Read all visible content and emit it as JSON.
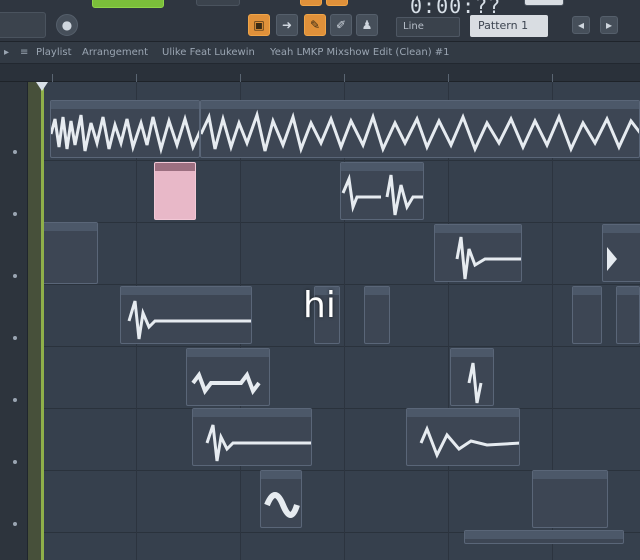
{
  "toolbar": {
    "time_display": "0:00:??",
    "snap_value": "Line",
    "pattern_value": "Pattern 1"
  },
  "breadcrumb": {
    "items": [
      "Playlist",
      "Arrangement",
      "Ulike Feat Lukewin",
      "Yeah LMKP Mixshow Edit (Clean) #1"
    ]
  },
  "overlay_text": "hi",
  "colors": {
    "background": "#36404d",
    "toolbar": "#2f3640",
    "accent_orange": "#e0913a",
    "accent_green": "#7bbf3a",
    "playhead": "#8fb04a",
    "clip_pink": "#e8b8c8"
  },
  "icons": {
    "record": "record-icon",
    "pattern_mode": "pattern-mode-icon",
    "arrow_tool": "arrow-icon",
    "brush_tool": "brush-icon",
    "pencil_tool": "pencil-icon",
    "user_tool": "stamp-icon"
  }
}
